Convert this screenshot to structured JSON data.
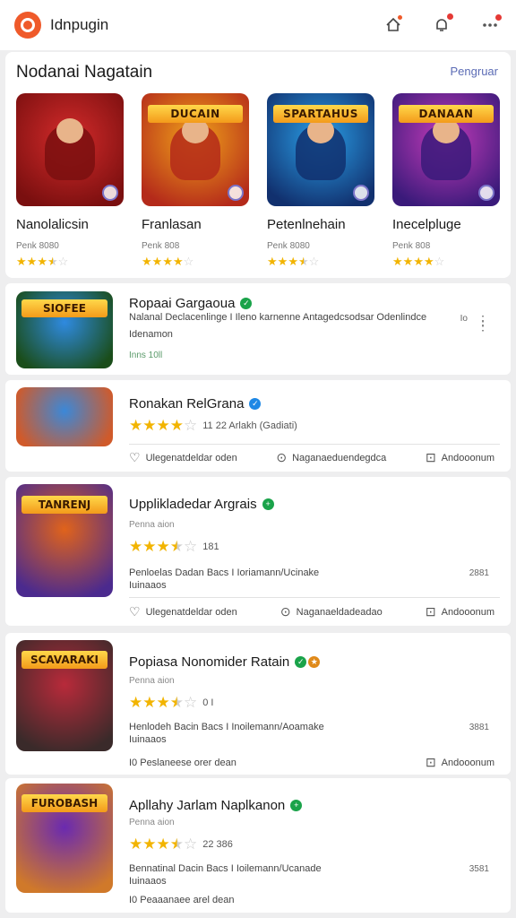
{
  "app": {
    "title": "Idnpugin"
  },
  "topbar": {
    "icons": [
      "home-icon",
      "notification-icon",
      "more-icon"
    ]
  },
  "featured": {
    "title": "Nodanai Nagatain",
    "link": "Pengruar",
    "items": [
      {
        "name": "Nanolalicsin",
        "meta": "Penk 8080",
        "rating": 3.5,
        "banner": "",
        "colors": [
          "#d42b2b",
          "#7a0f0f"
        ]
      },
      {
        "name": "Franlasan",
        "meta": "Penk 808",
        "rating": 4,
        "banner": "DUCAIN",
        "colors": [
          "#f0a21a",
          "#b42a1a"
        ]
      },
      {
        "name": "Petenlnehain",
        "meta": "Penk 8080",
        "rating": 3.5,
        "banner": "SPARTAHUS",
        "colors": [
          "#2aa0e8",
          "#11306e"
        ]
      },
      {
        "name": "Inecelpluge",
        "meta": "Penk 808",
        "rating": 4,
        "banner": "DANAAN",
        "colors": [
          "#c43bb9",
          "#3a1a7a"
        ]
      }
    ]
  },
  "list": [
    {
      "title": "Ropaai Gargaoua",
      "badge_color": "#1aa34a",
      "desc1": "Nalanal Declacenlinge I Ileno karnenne Antagedcsodsar Odenlindce",
      "desc2": "Idenamon",
      "small": "Inns 10ll",
      "right_num": "Io",
      "banner": "SIOFEE",
      "colors": [
        "#2f8ae0",
        "#1a4d1a"
      ]
    },
    {
      "title": "Ronakan RelGrana",
      "badge_color": "#1e88e5",
      "rating": 4,
      "rating_text": "11 22 Arlakh (Gadiati)",
      "actions": [
        "Ulegenatdeldar oden",
        "Naganaeduendegdca",
        "Andooonum"
      ],
      "banner": "",
      "colors": [
        "#3b88d8",
        "#d05a2a"
      ]
    },
    {
      "title": "Upplikladedar Argrais",
      "badge_color": "#1aa34a",
      "small": "Penna aion",
      "rating": 3.5,
      "rating_text": "181",
      "desc1": "Penloelas Dadan Bacs I Ioriamann/Ucinake",
      "desc2": "Iuinaaos",
      "right_num": "2881",
      "actions": [
        "Ulegenatdeldar oden",
        "Naganaeldadeadao",
        "Andooonum"
      ],
      "banner": "TANRENJ",
      "colors": [
        "#e0631b",
        "#4b2a8e"
      ]
    },
    {
      "title": "Popiasa Nonomider Ratain",
      "badge_color": "#1aa34a",
      "small": "Penna aion",
      "rating": 3.5,
      "rating_text": "0 I",
      "desc1": "Henlodeh Bacin Bacs I Inoilemann/Aoamake",
      "desc2": "Iuinaaos",
      "right_num": "3881",
      "actions": [
        "I0 Peslaneese orer dean",
        "Andooonum"
      ],
      "banner": "SCAVARAKI",
      "colors": [
        "#b82a3a",
        "#3a2a2a"
      ]
    },
    {
      "title": "Apllahy Jarlam Naplkanon",
      "badge_color": "#1aa34a",
      "small": "Penna aion",
      "rating": 3.5,
      "rating_text": "22 386",
      "desc1": "Bennatinal Dacin Bacs I Ioilemann/Ucanade",
      "desc2": "Iuinaaos",
      "right_num": "3581",
      "actions": [
        "I0 Peaaanaee arel dean"
      ],
      "banner": "FUROBASH",
      "colors": [
        "#6a2ab0",
        "#d0792a"
      ]
    }
  ]
}
